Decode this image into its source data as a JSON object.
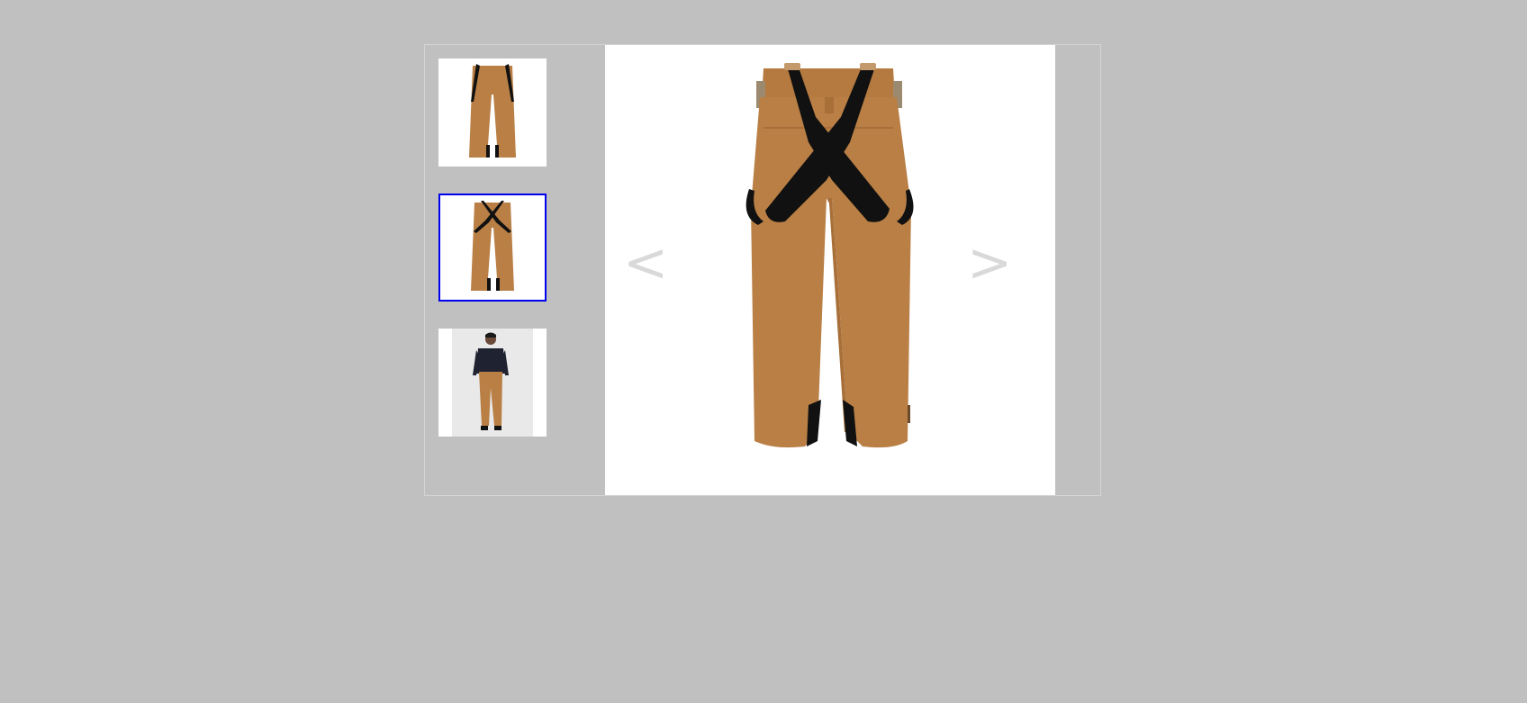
{
  "gallery": {
    "thumbnails": [
      {
        "icon": "pants-front-with-suspenders-image",
        "selected": false
      },
      {
        "icon": "pants-back-crossed-suspenders-image",
        "selected": true
      },
      {
        "icon": "model-wearing-pants-image",
        "selected": false
      }
    ],
    "main_image": {
      "icon": "pants-back-crossed-suspenders-image"
    },
    "prev_label": "<",
    "next_label": ">",
    "colors": {
      "pants": "#b97f45",
      "pants_shade": "#a86f39",
      "strap": "#111111",
      "selected_border": "#0000ee",
      "arrow": "#d9d9d9",
      "background": "#c0c0c0"
    }
  }
}
